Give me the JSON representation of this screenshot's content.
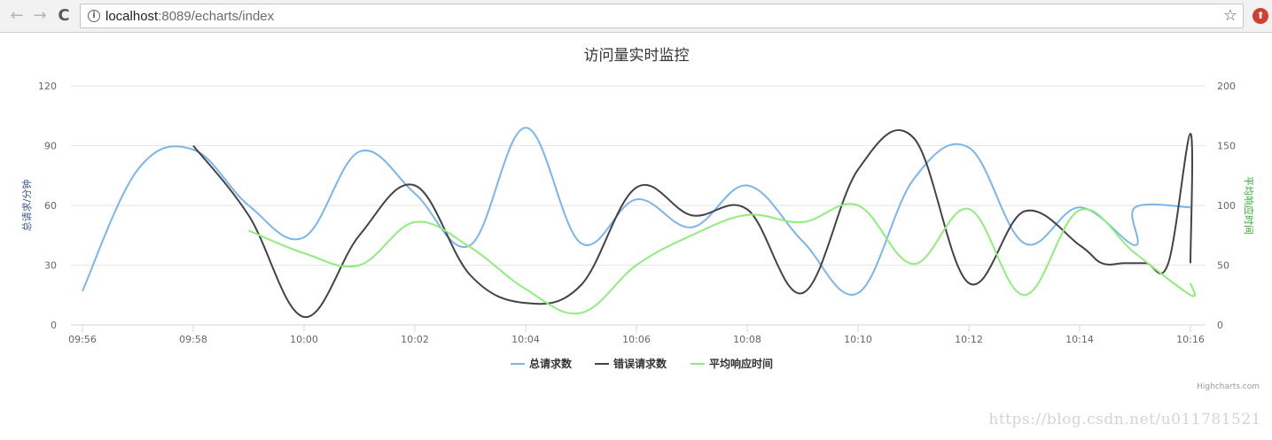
{
  "browser": {
    "url_host": "localhost",
    "url_path": ":8089/echarts/index",
    "back_glyph": "←",
    "forward_glyph": "→",
    "reload_glyph": "C",
    "info_glyph": "i",
    "star_glyph": "☆",
    "extension_glyph": "⬆"
  },
  "chart_data": {
    "type": "line",
    "title": "访问量实时监控",
    "y_left_label": "总请求/分钟",
    "y_right_label": "平均响应时间",
    "y_left_ticks": [
      "0",
      "30",
      "60",
      "90",
      "120"
    ],
    "y_right_ticks": [
      "0",
      "50",
      "100",
      "150",
      "200"
    ],
    "ylim_left": [
      0,
      120
    ],
    "ylim_right": [
      0,
      200
    ],
    "x_categories": [
      "09:56",
      "09:58",
      "10:00",
      "10:02",
      "10:04",
      "10:06",
      "10:08",
      "10:10",
      "10:12",
      "10:14",
      "10:16"
    ],
    "x_tick_minutes": [
      0,
      2,
      4,
      6,
      8,
      10,
      12,
      14,
      16,
      18,
      20
    ],
    "grid": true,
    "legend_position": "bottom-center",
    "credits": "Highcharts.com",
    "series": [
      {
        "name": "总请求数",
        "color": "#7cb5ec",
        "axis": "left",
        "x": [
          0,
          1,
          2,
          3,
          4,
          5,
          6,
          7,
          8,
          9,
          10,
          11,
          12,
          13,
          14,
          15,
          16,
          17,
          18,
          19,
          19,
          20
        ],
        "values": [
          17,
          78,
          88,
          60,
          44,
          87,
          66,
          40,
          99,
          41,
          63,
          49,
          70,
          42,
          16,
          73,
          89,
          41,
          59,
          40,
          59,
          59
        ]
      },
      {
        "name": "错误请求数",
        "color": "#434348",
        "axis": "left",
        "x": [
          2,
          3,
          4,
          5,
          6,
          7,
          8,
          9,
          10,
          11,
          12,
          13,
          14,
          15,
          16,
          17,
          18,
          19,
          20,
          21,
          22,
          23,
          23
        ],
        "values": [
          90,
          55,
          4,
          45,
          70,
          25,
          11,
          20,
          69,
          55,
          58,
          16,
          78,
          94,
          21,
          57,
          40,
          31,
          31,
          31,
          31,
          96,
          31
        ]
      },
      {
        "name": "平均响应时间",
        "color": "#90ed7d",
        "axis": "right",
        "x": [
          3,
          4,
          5,
          6,
          7,
          8,
          9,
          10,
          11,
          12,
          13,
          14,
          15,
          16,
          17,
          18,
          19,
          20,
          20
        ],
        "values": [
          79,
          60,
          50,
          86,
          65,
          30,
          10,
          50,
          75,
          92,
          86,
          100,
          51,
          97,
          25,
          96,
          60,
          25,
          35
        ]
      }
    ]
  },
  "watermark": "https://blog.csdn.net/u011781521"
}
